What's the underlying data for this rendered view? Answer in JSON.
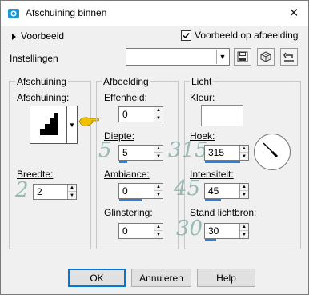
{
  "window": {
    "title": "Afschuining binnen",
    "close_glyph": "✕"
  },
  "preview": {
    "label": "Voorbeeld",
    "checkbox_label": "Voorbeeld op afbeelding",
    "checked": true
  },
  "settings": {
    "label": "Instellingen",
    "preset_value": ""
  },
  "groups": {
    "bevel": {
      "title": "Afschuining",
      "bevel_label": "Afschuining:",
      "width_label": "Breedte:",
      "width_value": "2",
      "deco_width": "2"
    },
    "image": {
      "title": "Afbeelding",
      "smoothness_label": "Effenheid:",
      "smoothness_value": "0",
      "depth_label": "Diepte:",
      "depth_value": "5",
      "deco_depth": "5",
      "ambience_label": "Ambiance:",
      "ambience_value": "0",
      "shininess_label": "Glinstering:",
      "shininess_value": "0"
    },
    "light": {
      "title": "Licht",
      "color_label": "Kleur:",
      "color_value": "#ffffff",
      "angle_label": "Hoek:",
      "angle_value": "315",
      "deco_angle": "315",
      "intensity_label": "Intensiteit:",
      "intensity_value": "45",
      "deco_intensity": "45",
      "elevation_label": "Stand lichtbron:",
      "elevation_value": "30",
      "deco_elevation": "30"
    }
  },
  "buttons": {
    "ok": "OK",
    "cancel": "Annuleren",
    "help": "Help"
  },
  "colors": {
    "accent": "#2f7fd6",
    "deco": "#8fb3ad",
    "hand": "#f2c200"
  }
}
